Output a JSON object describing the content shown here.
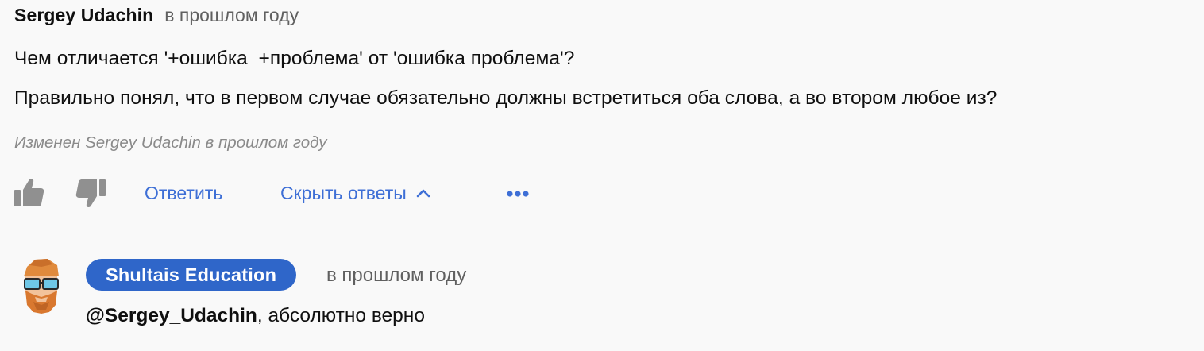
{
  "comment": {
    "author": "Sergey Udachin",
    "time": "в прошлом году",
    "lines": [
      "Чем отличается '+ошибка  +проблема' от 'ошибка проблема'?",
      "Правильно понял, что в первом случае обязательно должны встретиться оба слова, а во втором любое из?"
    ],
    "edited": "Изменен Sergey Udachin в прошлом году"
  },
  "actions": {
    "like_icon": "thumbs-up-icon",
    "dislike_icon": "thumbs-down-icon",
    "reply_label": "Ответить",
    "hide_replies_label": "Скрыть ответы",
    "chevron_icon": "chevron-up-icon",
    "more_icon": "more-horizontal-icon"
  },
  "reply": {
    "author": "Shultais Education",
    "time": "в прошлом году",
    "mention": "@Sergey_Udachin",
    "text": ", абсолютно верно"
  },
  "colors": {
    "background": "#f9f9f9",
    "link": "#3e6fd6",
    "badge": "#2f66c9",
    "muted": "#606060",
    "icon": "#909090"
  }
}
